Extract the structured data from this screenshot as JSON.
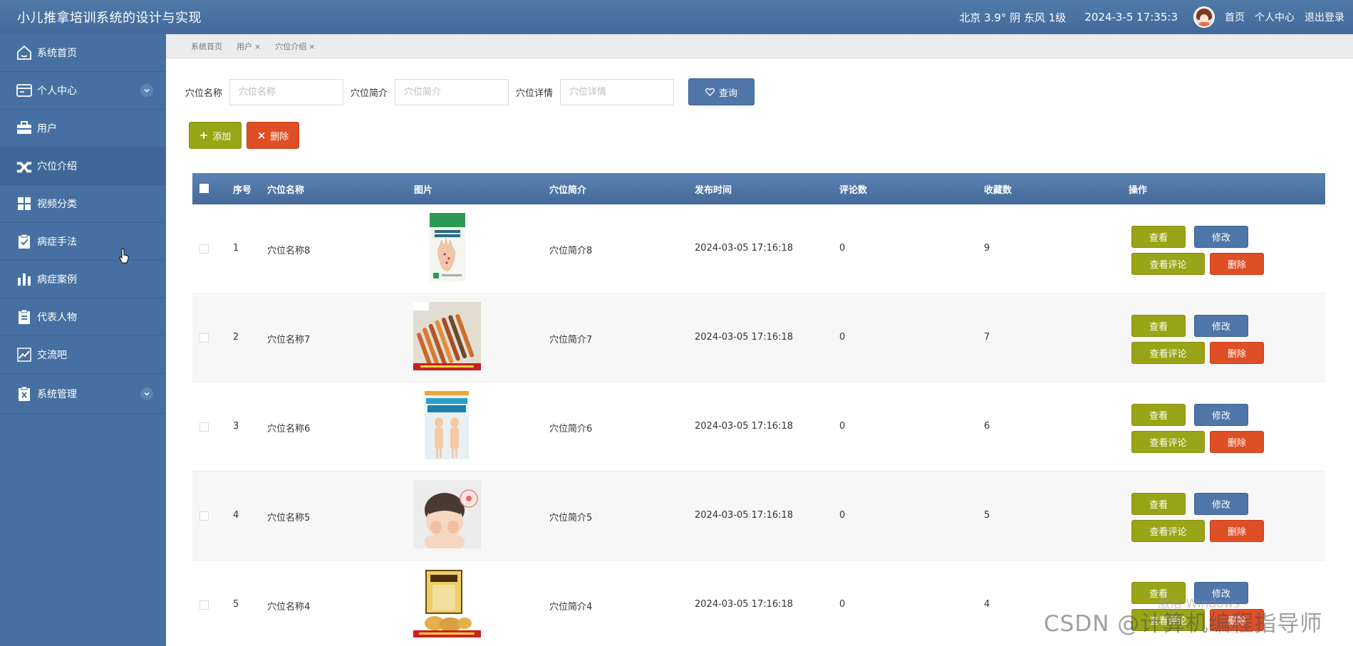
{
  "header": {
    "title": "小儿推拿培训系统的设计与实现",
    "weather": "北京 3.9° 阴 东风 1级",
    "datetime": "2024-3-5 17:35:3",
    "links": [
      "首页",
      "个人中心",
      "退出登录"
    ]
  },
  "sidebar": {
    "items": [
      {
        "label": "系统首页",
        "icon": "home-icon"
      },
      {
        "label": "个人中心",
        "icon": "id-card-icon",
        "expandable": true
      },
      {
        "label": "用户",
        "icon": "briefcase-icon"
      },
      {
        "label": "穴位介绍",
        "icon": "wrench-icon"
      },
      {
        "label": "视频分类",
        "icon": "grid-icon"
      },
      {
        "label": "病症手法",
        "icon": "clipboard-check-icon"
      },
      {
        "label": "病症案例",
        "icon": "bar-chart-icon"
      },
      {
        "label": "代表人物",
        "icon": "clipboard-list-icon"
      },
      {
        "label": "交流吧",
        "icon": "line-chart-icon"
      },
      {
        "label": "系统管理",
        "icon": "clipboard-x-icon",
        "expandable": true
      }
    ]
  },
  "tabs": [
    {
      "label": "系统首页",
      "closable": false
    },
    {
      "label": "用户",
      "closable": true
    },
    {
      "label": "穴位介绍",
      "closable": true
    }
  ],
  "search": {
    "fields": [
      {
        "label": "穴位名称",
        "placeholder": "穴位名称",
        "value": ""
      },
      {
        "label": "穴位简介",
        "placeholder": "穴位简介",
        "value": ""
      },
      {
        "label": "穴位详情",
        "placeholder": "穴位详情",
        "value": ""
      }
    ],
    "query_label": "查询"
  },
  "actions": {
    "add_label": "添加",
    "delete_label": "删除"
  },
  "table": {
    "headers": [
      "序号",
      "穴位名称",
      "图片",
      "穴位简介",
      "发布时间",
      "评论数",
      "收藏数",
      "操作"
    ],
    "rows": [
      {
        "index": "1",
        "name": "穴位名称8",
        "intro": "穴位简介8",
        "time": "2024-03-05 17:16:18",
        "comments": "0",
        "favorites": "9"
      },
      {
        "index": "2",
        "name": "穴位名称7",
        "intro": "穴位简介7",
        "time": "2024-03-05 17:16:18",
        "comments": "0",
        "favorites": "7"
      },
      {
        "index": "3",
        "name": "穴位名称6",
        "intro": "穴位简介6",
        "time": "2024-03-05 17:16:18",
        "comments": "0",
        "favorites": "6"
      },
      {
        "index": "4",
        "name": "穴位名称5",
        "intro": "穴位简介5",
        "time": "2024-03-05 17:16:18",
        "comments": "0",
        "favorites": "5"
      },
      {
        "index": "5",
        "name": "穴位名称4",
        "intro": "穴位简介4",
        "time": "2024-03-05 17:16:18",
        "comments": "0",
        "favorites": "4"
      }
    ],
    "row_actions": {
      "view": "查看",
      "edit": "修改",
      "comments": "查看评论",
      "delete": "删除"
    }
  },
  "overlay": {
    "watermark": "CSDN @计算机编程指导师",
    "windows_activation": "激活 Windows"
  },
  "colors": {
    "header_bg": "#4a73a3",
    "sidebar_bg": "#4670a1",
    "olive_button": "#9aa417",
    "red_button": "#de4f26",
    "blue_button": "#4f76a8"
  }
}
